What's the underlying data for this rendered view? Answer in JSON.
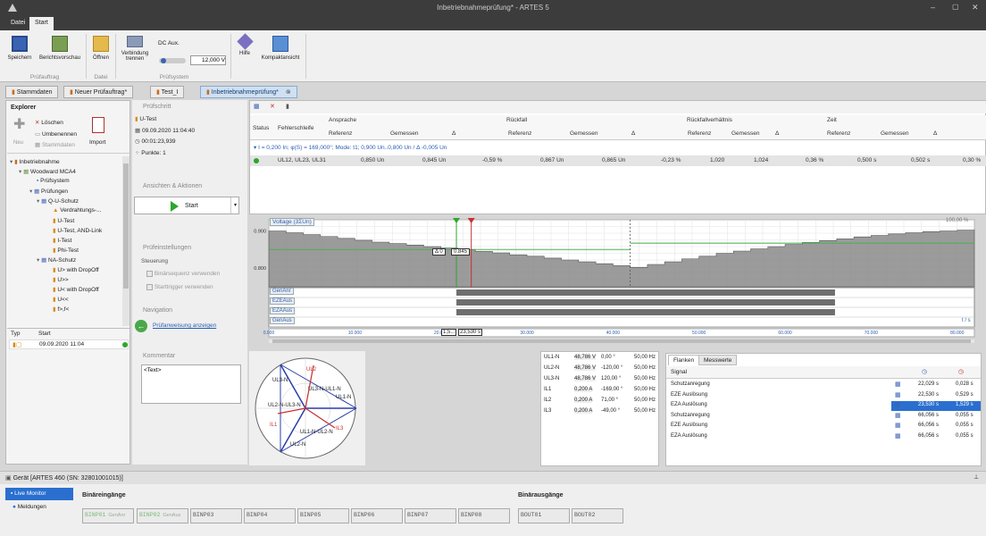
{
  "window": {
    "title": "Inbetriebnahmeprüfung* - ARTES 5"
  },
  "ribbon_tabs": [
    "Datei",
    "Start"
  ],
  "ribbon": {
    "buttons": [
      {
        "label": "Speichern"
      },
      {
        "label": "Berichtsvorschau"
      },
      {
        "label": "Öffnen"
      },
      {
        "label": "Verbindung trennen"
      },
      {
        "label": "Hilfe"
      },
      {
        "label": "Kompaktansicht"
      }
    ],
    "dc_aux_label": "DC Aux.",
    "dc_aux_value": "12,000 V",
    "dc_aux_slider": 0.1,
    "groups": [
      "Prüfauftrag",
      "Datei",
      "Prüfsystem"
    ]
  },
  "doc_tabs": [
    "Stammdaten",
    "Neuer Prüfauftrag*",
    "Test_I",
    "Inbetriebnahmeprüfung*"
  ],
  "explorer": {
    "title": "Explorer",
    "delete": "Löschen",
    "rename": "Umbenennen",
    "master": "Stammdaten",
    "new": "Neu",
    "import": "Import",
    "tree": [
      "Inbetriebnahme",
      "Woodward MCA4",
      "Prüfsystem",
      "Prüfungen",
      "Q-U-Schutz",
      "Verdrahtungs-...",
      "U-Test",
      "U-Test, AND-Link",
      "I-Test",
      "Phi-Test",
      "NA-Schutz",
      "U> with DropOff",
      "U>>",
      "U< with DropOff",
      "U<<",
      "f>,f<"
    ],
    "type_col": "Typ",
    "start_col": "Start",
    "start_value": "09.09.2020 11:04"
  },
  "step": {
    "title": "Prüfschritt",
    "name": "U-Test",
    "date": "09.09.2020 11:04:40",
    "duration": "00:01:23,939",
    "points": "Punkte: 1",
    "views_title": "Ansichten & Aktionen",
    "start": "Start",
    "settings_title": "Prüfeinstellungen",
    "control": "Steuerung",
    "binary_seq": "Binärsequenz verwenden",
    "start_trigger": "Starttrigger verwenden",
    "nav_title": "Navigation",
    "nav_link": "Prüfanweisung anzeigen",
    "comment_title": "Kommentar",
    "comment_text": "<Text>"
  },
  "results": {
    "group_headers": [
      "Ansprache",
      "Rückfall",
      "Rückfallverhältnis",
      "Zeit"
    ],
    "col_status": "Status",
    "col_fehler": "Fehlerschleife",
    "sub": [
      "Referenz",
      "Gemessen",
      "Δ"
    ],
    "group_row": "I = 0,200 In; φ(S) = 169,000°; Mode: t1; 0,900 Un..0,800 Un / Δ -0,005 Un",
    "row": [
      "UL12, UL23, UL31",
      "0,850 Un",
      "0,845 Un",
      "-0,59 %",
      "0,867 Un",
      "0,865 Un",
      "-0,23 %",
      "1,020",
      "1,024",
      "0,36 %",
      "0,500 s",
      "0,502 s",
      "0,30 %"
    ],
    "status_color": "#2ea62e"
  },
  "chart_data": {
    "type": "line",
    "ylabel": "Voltage (3ΣUn)",
    "unit": "t / s",
    "scale_label": "100,00 %",
    "x_ticks": [
      "0.000",
      "10.000",
      "20.000",
      "30.000",
      "40.000",
      "50.000",
      "60.000",
      "70.000",
      "80.000"
    ],
    "y_ticks": [
      "0.900",
      "0.800"
    ],
    "x_range": [
      0,
      82
    ],
    "y_range": [
      0.75,
      0.93
    ],
    "series": {
      "x": [
        0,
        2,
        4,
        6,
        8,
        10,
        12,
        14,
        16,
        18,
        20,
        22,
        24,
        26,
        28,
        30,
        32,
        34,
        36,
        38,
        40,
        42,
        44,
        46,
        48,
        50,
        52,
        54,
        56,
        58,
        60,
        62,
        64,
        66,
        68,
        70,
        72,
        74,
        76,
        78,
        80,
        82
      ],
      "values": [
        0.9,
        0.895,
        0.89,
        0.885,
        0.88,
        0.875,
        0.87,
        0.866,
        0.862,
        0.858,
        0.854,
        0.85,
        0.845,
        0.841,
        0.836,
        0.832,
        0.827,
        0.822,
        0.817,
        0.812,
        0.807,
        0.802,
        0.81,
        0.817,
        0.825,
        0.832,
        0.84,
        0.846,
        0.852,
        0.858,
        0.864,
        0.869,
        0.874,
        0.879,
        0.884,
        0.888,
        0.892,
        0.895,
        0.898,
        0.9,
        0.902,
        0.904
      ]
    },
    "cursor_labels": [
      "Δ 0",
      "0.845"
    ],
    "cursor_x_labels": [
      "1,5...",
      "23,530 s"
    ],
    "signals": [
      "GenAnr",
      "EZEAus",
      "EZAAus",
      "GenAus"
    ],
    "signal_bars": [
      [
        21.8,
        65.8
      ],
      [
        21.8,
        65.8
      ],
      [
        21.8,
        65.8
      ],
      null
    ]
  },
  "phasor": {
    "labels": [
      "UL2",
      "UL3-N",
      "UL3-N-UL1-N",
      "UL1-N",
      "UL2-N-UL3-N",
      "IL3",
      "IL1",
      "UL1-N-UL2-N",
      "UL2-N"
    ]
  },
  "measurements": [
    [
      "UL1-N",
      "48,786 V",
      "0,00 °",
      "50,00 Hz"
    ],
    [
      "UL2-N",
      "48,786 V",
      "-120,00 °",
      "50,00 Hz"
    ],
    [
      "UL3-N",
      "48,786 V",
      "120,00 °",
      "50,00 Hz"
    ],
    [
      "IL1",
      "0,200 A",
      "-169,00 °",
      "50,00 Hz"
    ],
    [
      "IL2",
      "0,200 A",
      "71,00 °",
      "50,00 Hz"
    ],
    [
      "IL3",
      "0,200 A",
      "-49,00 °",
      "50,00 Hz"
    ]
  ],
  "flanks": {
    "tabs": [
      "Flanken",
      "Messwerte"
    ],
    "col_signal": "Signal",
    "rows": [
      [
        "Schutzanregung",
        "22,029 s",
        "0,028 s"
      ],
      [
        "EZE Auslösung",
        "22,530 s",
        "0,529 s"
      ],
      [
        "EZA Auslösung",
        "23,530 s",
        "1,529 s"
      ],
      [
        "Schutzanregung",
        "66,056 s",
        "0,055 s"
      ],
      [
        "EZE Auslösung",
        "66,056 s",
        "0,055 s"
      ],
      [
        "EZA Auslösung",
        "66,056 s",
        "0,055 s"
      ]
    ],
    "selected": 2
  },
  "device": {
    "title": "Gerät [ARTES 460 (SN: 32801001015)]",
    "live": "Live Monitor",
    "messages": "Meldungen",
    "binin_title": "Binäreingänge",
    "binout_title": "Binärausgänge",
    "binin": [
      "BINP01",
      "BINP02",
      "BINP03",
      "BINP04",
      "BINP05",
      "BINP06",
      "BINP07",
      "BINP08"
    ],
    "binin_extra": [
      "GenAnr",
      "GenAus"
    ],
    "binout": [
      "BOUT01",
      "BOUT02"
    ]
  }
}
